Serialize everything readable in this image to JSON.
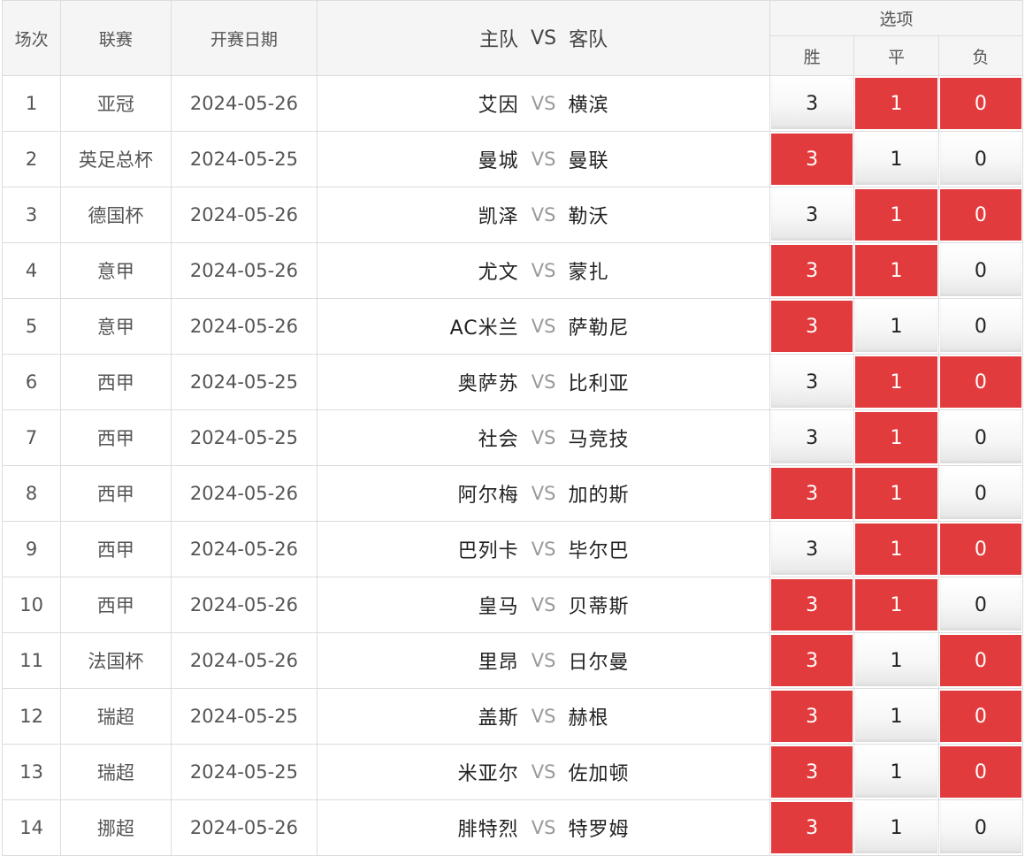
{
  "header": {
    "match": "场次",
    "league": "联赛",
    "date": "开赛日期",
    "home": "主队",
    "vs": "VS",
    "away": "客队",
    "options": "选项",
    "win": "胜",
    "draw": "平",
    "lose": "负"
  },
  "colors": {
    "selected": "#e23b3d",
    "border": "#dcdcdc",
    "header_bg": "#f5f5f5"
  },
  "rows": [
    {
      "no": "1",
      "league": "亚冠",
      "date": "2024-05-26",
      "home": "艾因",
      "away": "横滨",
      "vs": "VS",
      "win": "3",
      "draw": "1",
      "lose": "0",
      "sel": [
        false,
        true,
        true
      ]
    },
    {
      "no": "2",
      "league": "英足总杯",
      "date": "2024-05-25",
      "home": "曼城",
      "away": "曼联",
      "vs": "VS",
      "win": "3",
      "draw": "1",
      "lose": "0",
      "sel": [
        true,
        false,
        false
      ]
    },
    {
      "no": "3",
      "league": "德国杯",
      "date": "2024-05-26",
      "home": "凯泽",
      "away": "勒沃",
      "vs": "VS",
      "win": "3",
      "draw": "1",
      "lose": "0",
      "sel": [
        false,
        true,
        true
      ]
    },
    {
      "no": "4",
      "league": "意甲",
      "date": "2024-05-26",
      "home": "尤文",
      "away": "蒙扎",
      "vs": "VS",
      "win": "3",
      "draw": "1",
      "lose": "0",
      "sel": [
        true,
        true,
        false
      ]
    },
    {
      "no": "5",
      "league": "意甲",
      "date": "2024-05-26",
      "home": "AC米兰",
      "away": "萨勒尼",
      "vs": "VS",
      "win": "3",
      "draw": "1",
      "lose": "0",
      "sel": [
        true,
        false,
        false
      ]
    },
    {
      "no": "6",
      "league": "西甲",
      "date": "2024-05-25",
      "home": "奥萨苏",
      "away": "比利亚",
      "vs": "VS",
      "win": "3",
      "draw": "1",
      "lose": "0",
      "sel": [
        false,
        true,
        true
      ]
    },
    {
      "no": "7",
      "league": "西甲",
      "date": "2024-05-25",
      "home": "社会",
      "away": "马竞技",
      "vs": "VS",
      "win": "3",
      "draw": "1",
      "lose": "0",
      "sel": [
        false,
        true,
        false
      ]
    },
    {
      "no": "8",
      "league": "西甲",
      "date": "2024-05-26",
      "home": "阿尔梅",
      "away": "加的斯",
      "vs": "VS",
      "win": "3",
      "draw": "1",
      "lose": "0",
      "sel": [
        true,
        true,
        false
      ]
    },
    {
      "no": "9",
      "league": "西甲",
      "date": "2024-05-26",
      "home": "巴列卡",
      "away": "毕尔巴",
      "vs": "VS",
      "win": "3",
      "draw": "1",
      "lose": "0",
      "sel": [
        false,
        true,
        true
      ]
    },
    {
      "no": "10",
      "league": "西甲",
      "date": "2024-05-26",
      "home": "皇马",
      "away": "贝蒂斯",
      "vs": "VS",
      "win": "3",
      "draw": "1",
      "lose": "0",
      "sel": [
        true,
        true,
        false
      ]
    },
    {
      "no": "11",
      "league": "法国杯",
      "date": "2024-05-26",
      "home": "里昂",
      "away": "日尔曼",
      "vs": "VS",
      "win": "3",
      "draw": "1",
      "lose": "0",
      "sel": [
        true,
        false,
        true
      ]
    },
    {
      "no": "12",
      "league": "瑞超",
      "date": "2024-05-25",
      "home": "盖斯",
      "away": "赫根",
      "vs": "VS",
      "win": "3",
      "draw": "1",
      "lose": "0",
      "sel": [
        true,
        false,
        true
      ]
    },
    {
      "no": "13",
      "league": "瑞超",
      "date": "2024-05-25",
      "home": "米亚尔",
      "away": "佐加顿",
      "vs": "VS",
      "win": "3",
      "draw": "1",
      "lose": "0",
      "sel": [
        true,
        false,
        true
      ]
    },
    {
      "no": "14",
      "league": "挪超",
      "date": "2024-05-26",
      "home": "腓特烈",
      "away": "特罗姆",
      "vs": "VS",
      "win": "3",
      "draw": "1",
      "lose": "0",
      "sel": [
        true,
        false,
        false
      ]
    }
  ]
}
